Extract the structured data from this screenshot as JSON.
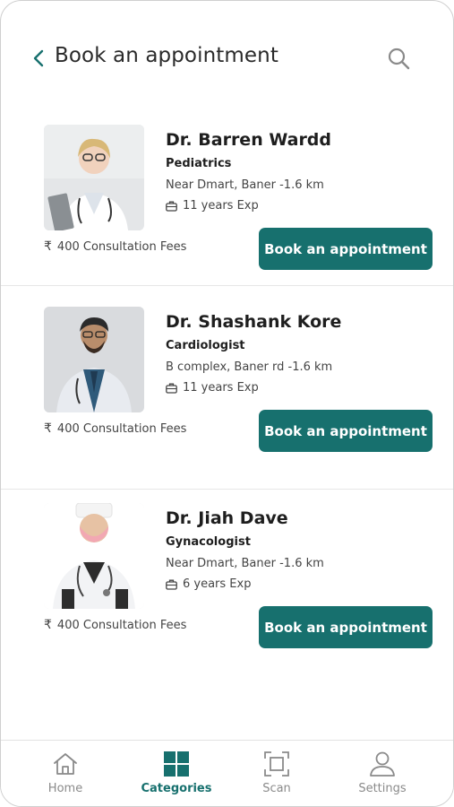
{
  "header": {
    "title": "Book an appointment",
    "back_icon": "chevron-left-icon",
    "search_icon": "search-icon"
  },
  "colors": {
    "accent": "#17706e",
    "nav_inactive": "#8a8a8a"
  },
  "doctors": [
    {
      "name": "Dr. Barren Wardd",
      "specialty": "Pediatrics",
      "location": "Near Dmart, Baner -1.6 km",
      "experience": "11 years Exp",
      "fees": "400 Consultation Fees",
      "book_label": "Book an appointment"
    },
    {
      "name": "Dr. Shashank Kore",
      "specialty": "Cardiologist",
      "location": "B complex, Baner rd -1.6 km",
      "experience": "11 years Exp",
      "fees": "400 Consultation Fees",
      "book_label": "Book an appointment"
    },
    {
      "name": "Dr. Jiah Dave",
      "specialty": "Gynacologist",
      "location": "Near Dmart, Baner -1.6 km",
      "experience": "6 years Exp",
      "fees": "400 Consultation Fees",
      "book_label": "Book an appointment"
    }
  ],
  "currency_symbol": "₹",
  "nav": {
    "items": [
      {
        "label": "Home",
        "icon": "home-icon",
        "active": false
      },
      {
        "label": "Categories",
        "icon": "grid-icon",
        "active": true
      },
      {
        "label": "Scan",
        "icon": "scan-icon",
        "active": false
      },
      {
        "label": "Settings",
        "icon": "user-icon",
        "active": false
      }
    ]
  }
}
